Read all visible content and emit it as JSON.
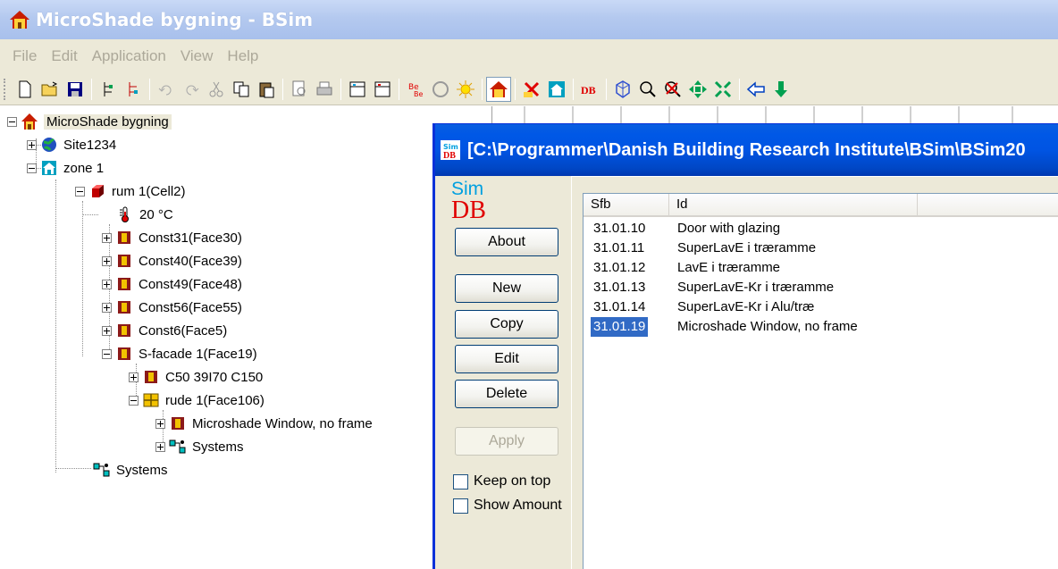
{
  "window": {
    "title": "MicroShade bygning - BSim"
  },
  "menu": [
    "File",
    "Edit",
    "Application",
    "View",
    "Help"
  ],
  "tree": {
    "root": "MicroShade bygning",
    "nodes": [
      "Site1234",
      "zone 1",
      "rum 1(Cell2)",
      "20 °C",
      "Const31(Face30)",
      "Const40(Face39)",
      "Const49(Face48)",
      "Const56(Face55)",
      "Const6(Face5)",
      "S-facade 1(Face19)",
      "C50 39I70 C150",
      "rude 1(Face106)",
      "Microshade Window, no frame",
      "Systems",
      "Systems"
    ]
  },
  "dialog": {
    "title": "[C:\\Programmer\\Danish Building Research Institute\\BSim\\BSim20",
    "title_icon_text": "Sim DB",
    "logo_sim": "Sim",
    "logo_db": "DB",
    "buttons": {
      "about": "About",
      "new": "New",
      "copy": "Copy",
      "edit": "Edit",
      "delete": "Delete",
      "apply": "Apply"
    },
    "checkboxes": {
      "keep_on_top": "Keep on top",
      "show_amount": "Show Amount"
    },
    "list": {
      "columns": [
        "Sfb",
        "Id"
      ],
      "rows": [
        {
          "sfb": "31.01.10",
          "id": "Door with glazing"
        },
        {
          "sfb": "31.01.11",
          "id": "SuperLavE i træramme"
        },
        {
          "sfb": "31.01.12",
          "id": "LavE i træramme"
        },
        {
          "sfb": "31.01.13",
          "id": "SuperLavE-Kr i træramme"
        },
        {
          "sfb": "31.01.14",
          "id": "SuperLavE-Kr i Alu/træ"
        },
        {
          "sfb": "31.01.19",
          "id": "Microshade Window, no frame"
        }
      ],
      "selected_sfb": "31.01.19"
    }
  },
  "colors": {
    "xp_blue": "#0054e3",
    "inactive_title": "#b4c9ef",
    "selection": "#316ac5",
    "face_frame": "#8b1a1a",
    "face_fill": "#f2c200"
  }
}
